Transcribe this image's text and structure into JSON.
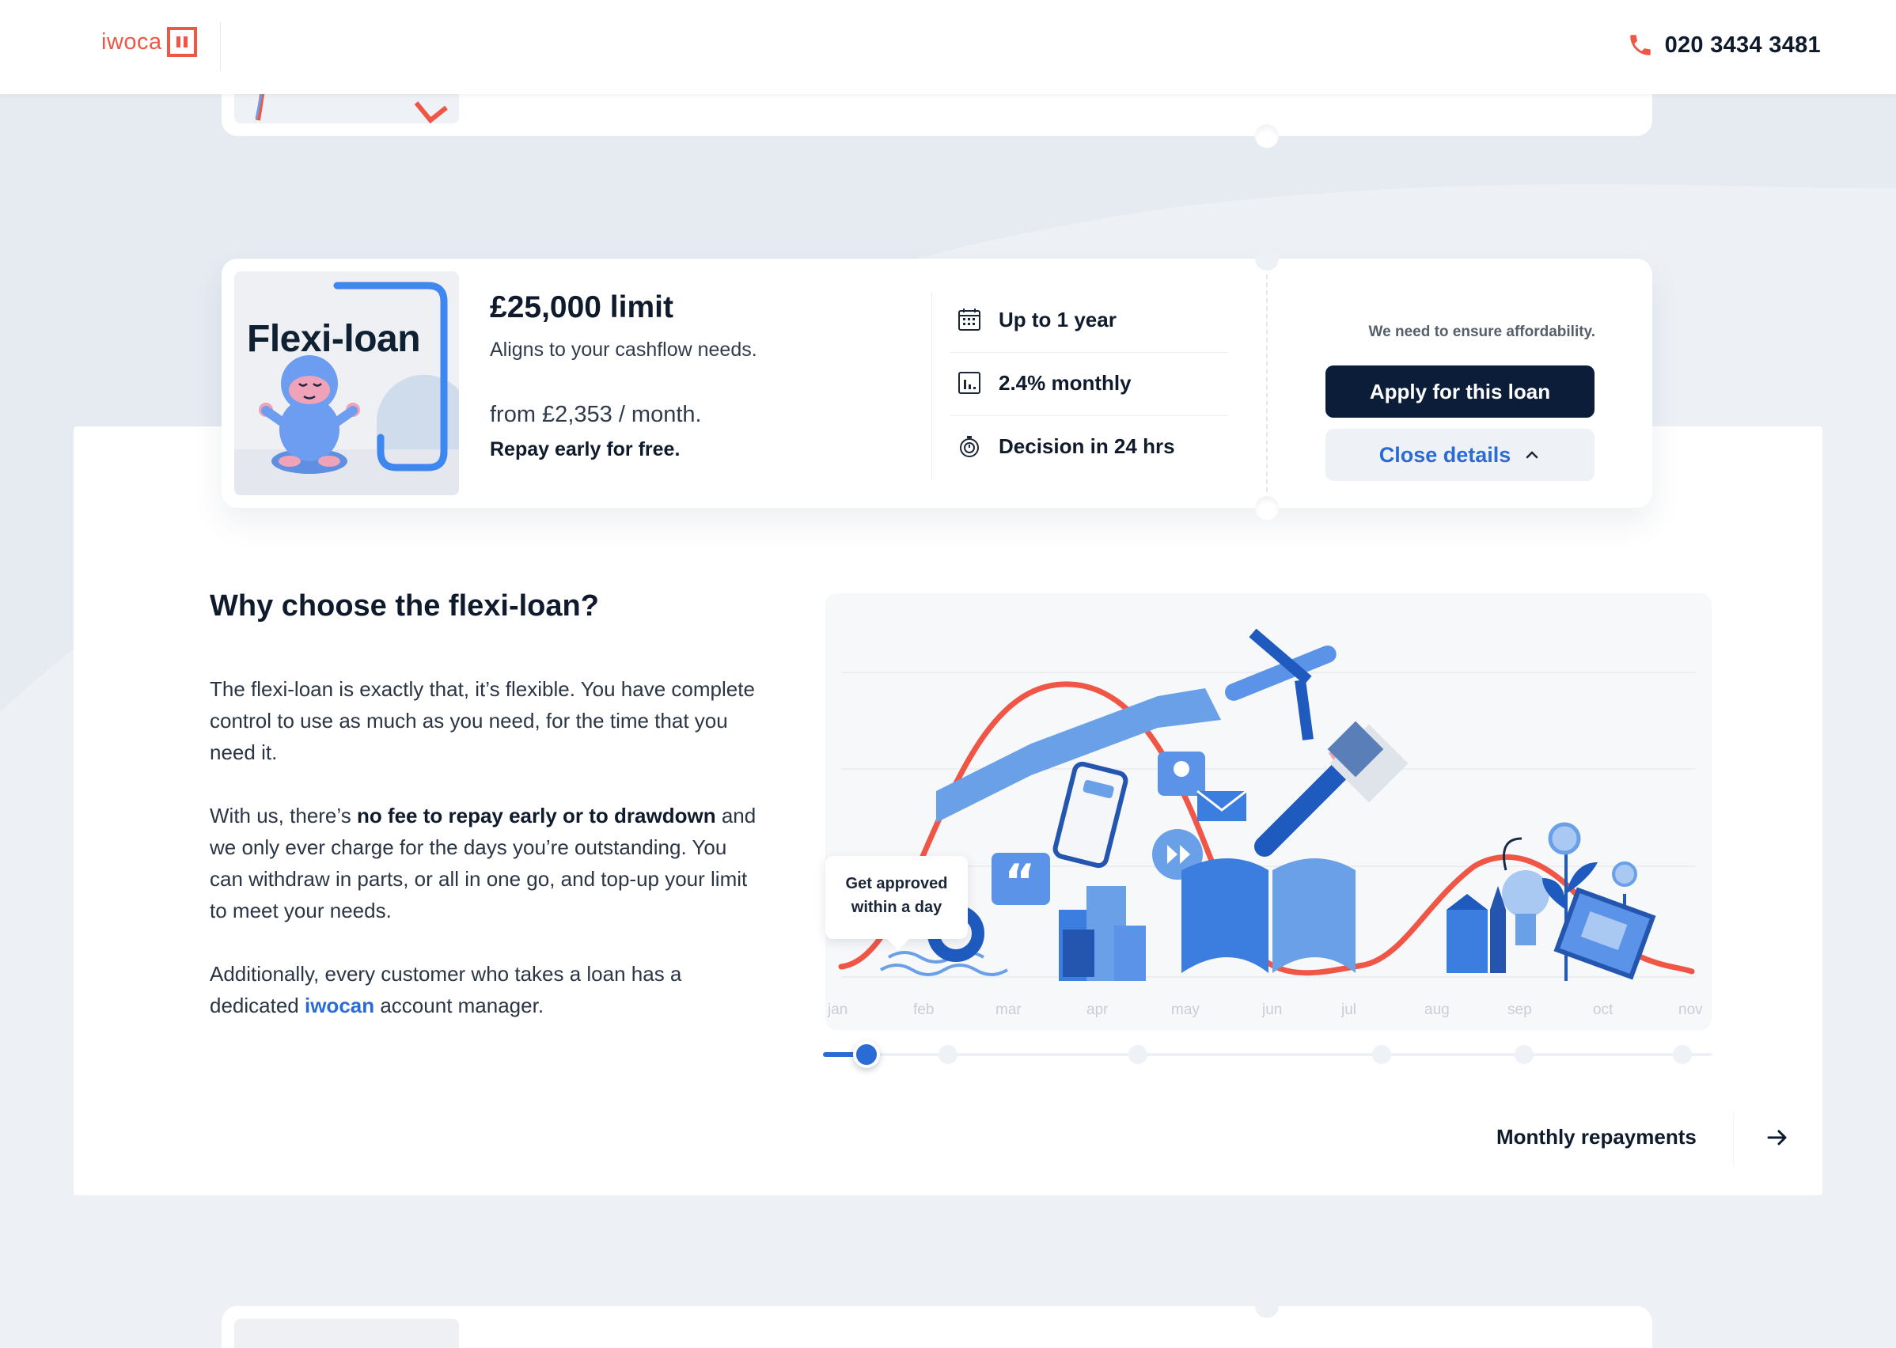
{
  "header": {
    "logo_text": "iwoca",
    "phone_number": "020 3434 3481"
  },
  "card": {
    "thumb_title": "Flexi-loan",
    "limit": "£25,000 limit",
    "tagline": "Aligns to your cashflow needs.",
    "from_price": "from £2,353 / month.",
    "repay_note": "Repay early for free.",
    "features": [
      {
        "icon": "calendar-icon",
        "label": "Up to 1 year"
      },
      {
        "icon": "chart-icon",
        "label": "2.4% monthly"
      },
      {
        "icon": "stopwatch-icon",
        "label": "Decision in 24 hrs"
      }
    ],
    "affordability_note": "We need to ensure affordability.",
    "apply_label": "Apply for this loan",
    "close_label": "Close details"
  },
  "details": {
    "title": "Why choose the flexi-loan?",
    "para1": "The flexi-loan is exactly that, it’s flexible. You have complete control to use as much as you need, for the time that you need it.",
    "para2_pre": "With us, there’s ",
    "para2_bold": "no fee to repay early or to drawdown",
    "para2_post": " and we only ever charge for the days you’re outstanding. You can withdraw in parts, or all in one go, and top-up your limit to meet your needs.",
    "para3_pre": "Additionally, every customer who takes a loan has a dedicated ",
    "para3_link": "iwocan",
    "para3_post": " account manager."
  },
  "illustration": {
    "months": [
      "jan",
      "feb",
      "mar",
      "apr",
      "may",
      "jun",
      "jul",
      "aug",
      "sep",
      "oct",
      "nov"
    ],
    "tooltip_line1": "Get approved",
    "tooltip_line2": "within a day",
    "slider_step": 1,
    "slider_steps": 7
  },
  "footer_nav": {
    "next_label": "Monthly repayments"
  },
  "colors": {
    "brand": "#ef5646",
    "primary_button": "#0c1d3a",
    "accent_blue": "#2a6bd6",
    "curve_red": "#ef5646"
  }
}
